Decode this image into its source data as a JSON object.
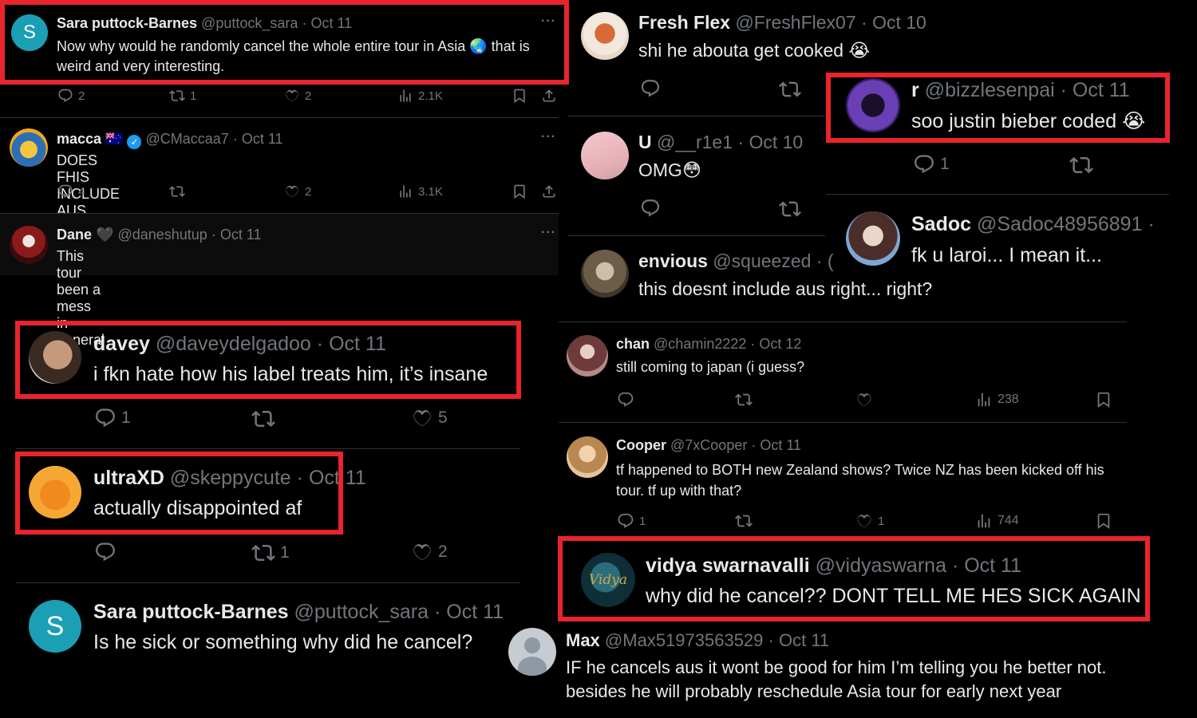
{
  "tweets": {
    "sara1": {
      "name": "Sara puttock-Barnes",
      "handle": "@puttock_sara",
      "date": "Oct 11",
      "text": "Now why would he randomly cancel the whole entire tour in Asia 🌏 that is weird and very interesting.",
      "replies": "2",
      "retweets": "1",
      "likes": "2",
      "views": "2.1K",
      "avatar_letter": "S"
    },
    "macca": {
      "name": "macca 🇦🇺",
      "handle": "@CMaccaa7",
      "date": "Oct 11",
      "text": "DOES FHIS INCLUDE AUS PLEASE SAY NO",
      "replies": "4",
      "likes": "2",
      "views": "3.1K"
    },
    "dane": {
      "name": "Dane 🖤",
      "handle": "@daneshutup",
      "date": "Oct 11",
      "text": "This tour been a mess in general"
    },
    "davey": {
      "name": "davey",
      "handle": "@daveydelgadoo",
      "date": "Oct 11",
      "text": "i fkn hate how his label treats him, it’s insane",
      "replies": "1",
      "likes": "5"
    },
    "ultra": {
      "name": "ultraXD",
      "handle": "@skeppycute",
      "date": "Oct 11",
      "text": "actually disappointed af",
      "retweets": "1",
      "likes": "2"
    },
    "sara2": {
      "name": "Sara puttock-Barnes",
      "handle": "@puttock_sara",
      "date": "Oct 11",
      "text": "Is he sick or something why did he cancel?",
      "avatar_letter": "S"
    },
    "fresh": {
      "name": "Fresh Flex",
      "handle": "@FreshFlex07",
      "date": "Oct 10",
      "text": "shi he abouta get cooked 😭"
    },
    "r": {
      "name": "r",
      "handle": "@bizzlesenpai",
      "date": "Oct 11",
      "text": "soo justin bieber coded 😭",
      "replies": "1"
    },
    "u": {
      "name": "U",
      "handle": "@__r1e1",
      "date": "Oct 10",
      "text": "OMG😳"
    },
    "sadoc": {
      "name": "Sadoc",
      "handle": "@Sadoc48956891",
      "date": "·",
      "text": "fk u laroi... I mean it..."
    },
    "envious": {
      "name": "envious",
      "handle": "@squeezed",
      "date": "· (",
      "text": "this doesnt include aus right... right?"
    },
    "chan": {
      "name": "chan",
      "handle": "@chamin2222",
      "date": "Oct 12",
      "text": "still coming to japan (i guess?",
      "views": "238"
    },
    "cooper": {
      "name": "Cooper",
      "handle": "@7xCooper",
      "date": "Oct 11",
      "text": "tf happened to BOTH new Zealand shows? Twice NZ has been kicked off his tour. tf up with that?",
      "replies": "1",
      "likes": "1",
      "views": "744"
    },
    "vidya": {
      "name": "vidya swarnavalli",
      "handle": "@vidyaswarna",
      "date": "Oct 11",
      "text": "why did he cancel?? DONT TELL ME HES SICK AGAIN",
      "avatar_text": "Vidya"
    },
    "max": {
      "name": "Max",
      "handle": "@Max51973563529",
      "date": "Oct 11",
      "text": "IF he cancels aus it wont be good for him I’m telling you he better not. besides he will probably reschedule Asia tour for early next year"
    }
  },
  "more_label": "···",
  "colors": {
    "highlight": "#e8242c",
    "muted": "#71767b",
    "text": "#e7e9ea",
    "verified": "#1d9bf0",
    "background": "#000000"
  },
  "icons": [
    "reply-icon",
    "retweet-icon",
    "like-icon",
    "views-icon",
    "bookmark-icon",
    "share-icon",
    "verified-icon",
    "more-icon"
  ]
}
